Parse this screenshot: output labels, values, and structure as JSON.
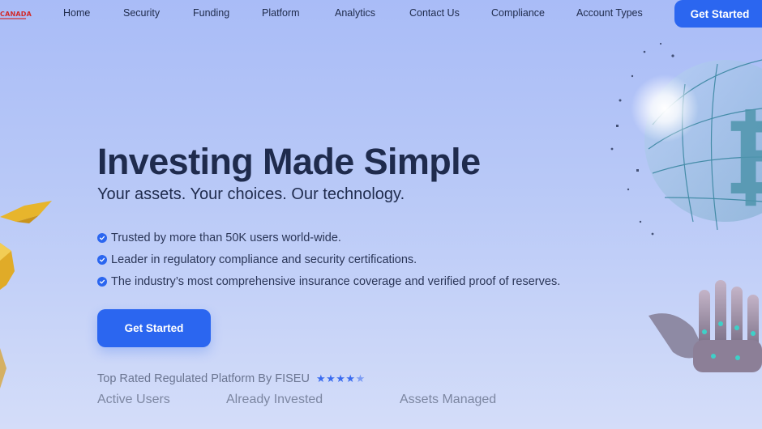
{
  "brand": {
    "logo_text": "CANADA"
  },
  "nav": {
    "links": [
      "Home",
      "Security",
      "Funding",
      "Platform",
      "Analytics",
      "Contact Us",
      "Compliance",
      "Account Types"
    ],
    "cta_label": "Get Started"
  },
  "hero": {
    "title": "Investing Made Simple",
    "subtitle": "Your assets. Your choices. Our technology.",
    "features": [
      "Trusted by more than 50K users world-wide.",
      "Leader in regulatory compliance and security certifications.",
      "The industry’s most comprehensive insurance coverage and verified proof of reserves."
    ],
    "cta_label": "Get Started",
    "rating_text": "Top Rated Regulated Platform By FISEU",
    "rating_stars": 4.5
  },
  "stats": {
    "labels": [
      "Active Users",
      "Already Invested",
      "Assets Managed"
    ]
  },
  "colors": {
    "accent": "#2b66f0",
    "title": "#1f2b4d",
    "brand_red": "#d22a2a"
  },
  "icons": {
    "feature_check": "check-circle-icon",
    "rating_star": "star-icon"
  }
}
